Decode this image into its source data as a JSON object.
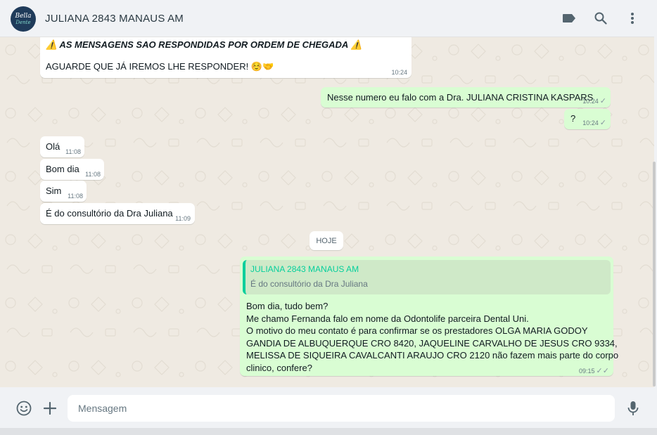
{
  "header": {
    "contact_name": "JULIANA 2843 MANAUS AM",
    "avatar_line1": "Bella",
    "avatar_line2": "Dente",
    "icons": [
      "label-icon",
      "search-icon",
      "menu-icon"
    ]
  },
  "messages": {
    "m1_warning": "AS MENSAGENS SAO RESPONDIDAS POR ORDEM DE CHEGADA",
    "m1_text": "AGUARDE QUE JÁ IREMOS LHE RESPONDER!",
    "m1_time": "10:24",
    "m2_text": "Nesse numero eu falo com a Dra. JULIANA CRISTINA KASPARS",
    "m2_time": "10:24",
    "m3_text": "?",
    "m3_time": "10:24",
    "m4_text": "Olá",
    "m4_time": "11:08",
    "m5_text": "Bom dia",
    "m5_time": "11:08",
    "m6_text": "Sim",
    "m6_time": "11:08",
    "m7_text": "É do consultório da Dra Juliana",
    "m7_time": "11:09",
    "day_label": "HOJE",
    "m8_quote_name": "JULIANA 2843 MANAUS AM",
    "m8_quote_text": "É do consultório da Dra Juliana",
    "m8_lines": [
      "Bom dia, tudo bem?",
      "Me chamo Fernanda falo em nome da Odontolife parceira Dental Uni.",
      "O motivo do meu contato é para confirmar se os prestadores OLGA MARIA GODOY",
      "GANDIA DE ALBUQUERQUE CRO 8420, JAQUELINE CARVALHO DE JESUS CRO 9334,",
      "MELISSA DE SIQUEIRA CAVALCANTI ARAUJO CRO 2120 não fazem mais parte do corpo",
      "clinico, confere?"
    ],
    "m8_time": "09:15"
  },
  "composer": {
    "placeholder": "Mensagem",
    "icons": [
      "emoji-icon",
      "attach-plus-icon",
      "microphone-icon"
    ]
  },
  "colors": {
    "incoming": "#ffffff",
    "outgoing": "#d9fdd3",
    "accent": "#06cf9c",
    "background": "#efeae2"
  }
}
